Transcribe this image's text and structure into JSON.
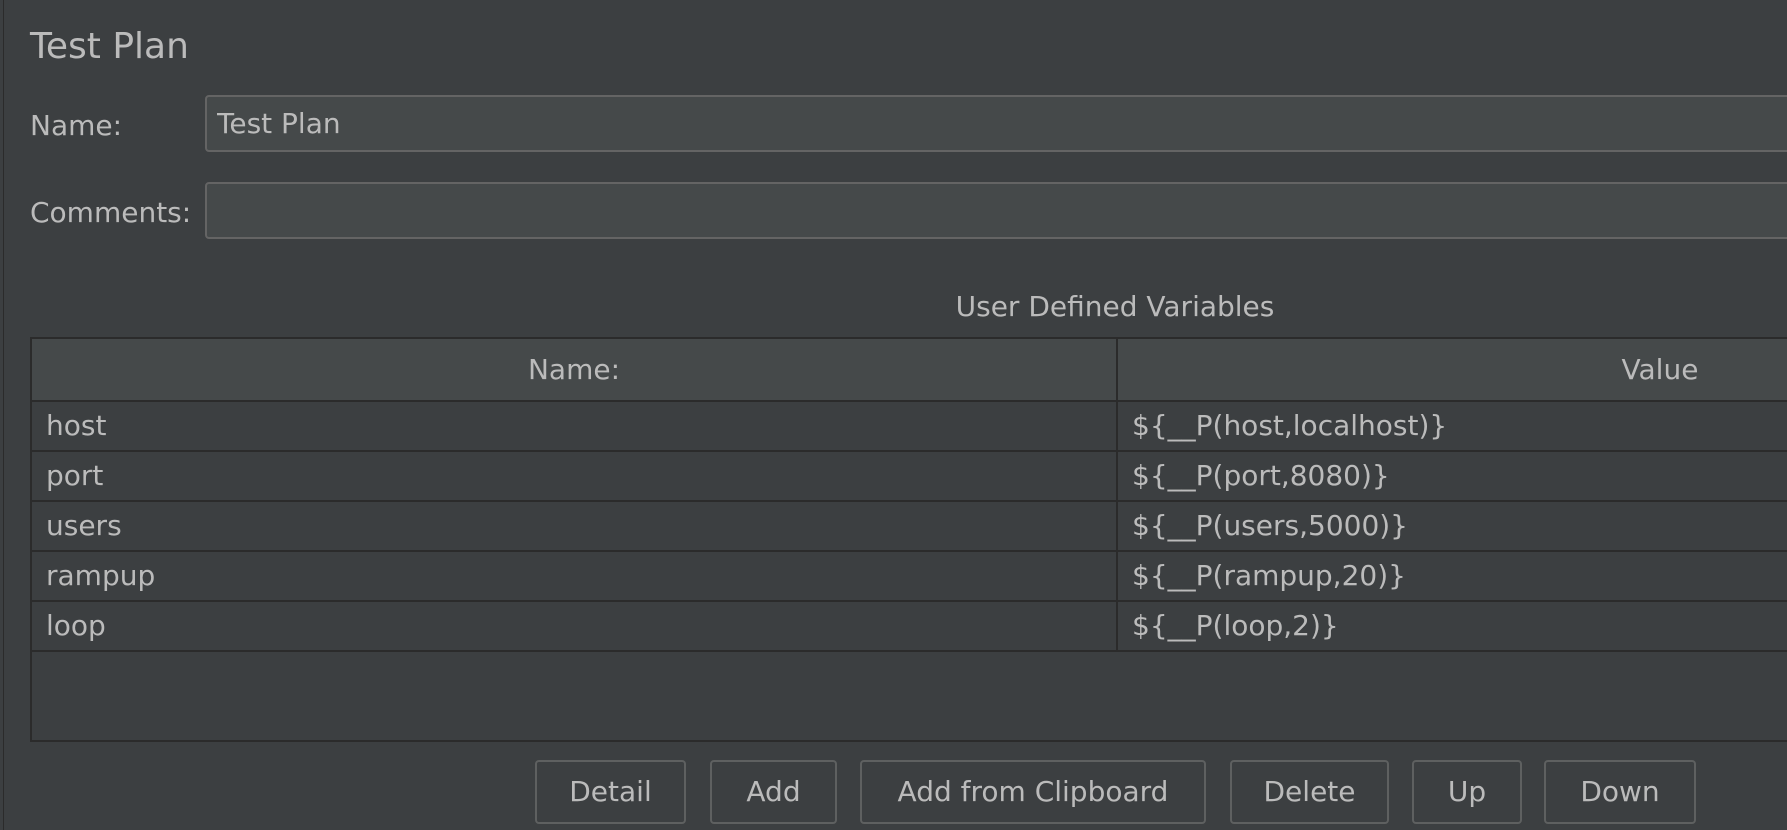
{
  "panel": {
    "title": "Test Plan"
  },
  "form": {
    "name_label": "Name:",
    "name_value": "Test Plan",
    "comments_label": "Comments:",
    "comments_value": ""
  },
  "variables": {
    "section_title": "User Defined Variables",
    "columns": [
      "Name:",
      "Value"
    ],
    "rows": [
      {
        "name": "host",
        "value": "${__P(host,localhost)}"
      },
      {
        "name": "port",
        "value": "${__P(port,8080)}"
      },
      {
        "name": "users",
        "value": "${__P(users,5000)}"
      },
      {
        "name": "rampup",
        "value": "${__P(rampup,20)}"
      },
      {
        "name": "loop",
        "value": "${__P(loop,2)}"
      }
    ]
  },
  "buttons": {
    "detail": "Detail",
    "add": "Add",
    "add_from_clipboard": "Add from Clipboard",
    "delete": "Delete",
    "up": "Up",
    "down": "Down"
  },
  "colors": {
    "background": "#3c3f41",
    "field_background": "#45494a",
    "text": "#bbbbbb",
    "border": "#2b2b2b"
  }
}
